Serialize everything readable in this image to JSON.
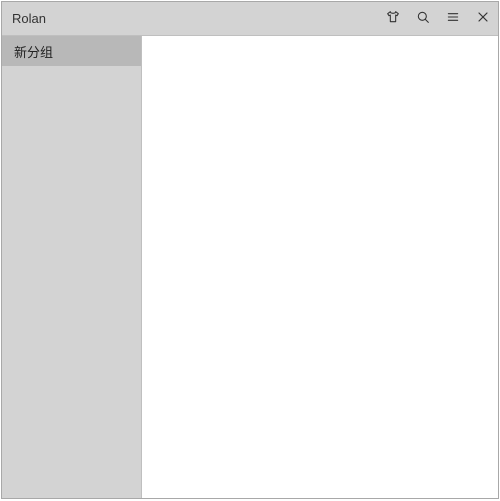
{
  "window": {
    "title": "Rolan"
  },
  "icons": {
    "theme": "shirt-icon",
    "search": "search-icon",
    "menu": "menu-icon",
    "close": "close-icon"
  },
  "sidebar": {
    "items": [
      {
        "label": "新分组",
        "selected": true
      }
    ]
  }
}
